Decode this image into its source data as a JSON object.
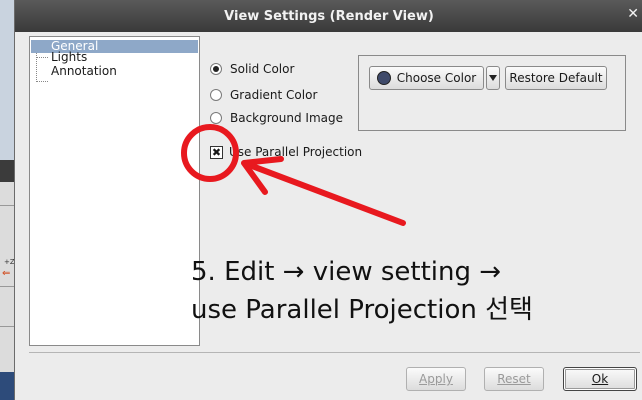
{
  "dialog": {
    "title": "View Settings (Render View)",
    "close_glyph": "✕"
  },
  "tree": {
    "items": [
      "General",
      "Lights",
      "Annotation"
    ],
    "selected": "General"
  },
  "background": {
    "options": [
      "Solid Color",
      "Gradient Color",
      "Background Image"
    ],
    "selected": "Solid Color"
  },
  "color_group": {
    "choose_color_label": "Choose Color",
    "restore_default_label": "Restore Default",
    "swatch_color": "#3f4a6a"
  },
  "projection": {
    "label": "Use Parallel Projection",
    "checked": true,
    "check_glyph": "✖"
  },
  "buttons": {
    "apply_label": "Apply",
    "reset_label": "Reset",
    "ok_label": "Ok"
  },
  "annotation": {
    "line1": "5. Edit → view setting →",
    "line2": "use Parallel Projection 선택",
    "color": "#e8191f"
  },
  "background_app": {
    "axis_label": "+Z"
  }
}
